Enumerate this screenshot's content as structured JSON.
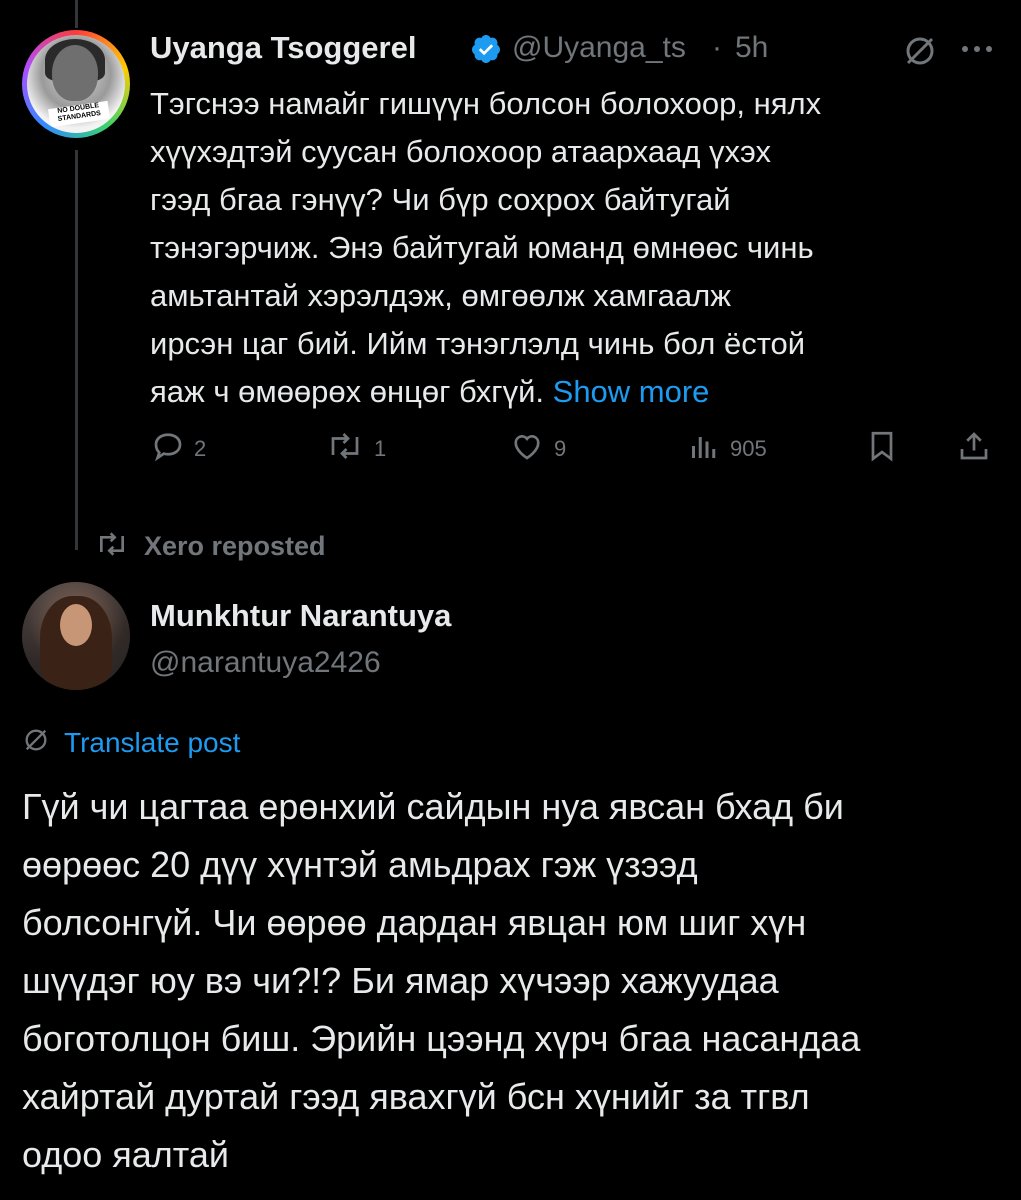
{
  "tweet1": {
    "name": "Uyanga Tsoggerel",
    "handle": "@Uyanga_ts",
    "separator": "·",
    "time": "5h",
    "avatar_badge": "NO DOUBLE STANDARDS",
    "text_lines": [
      "Тэгснээ намайг гишүүн болсон болохоор, нялх",
      "хүүхэдтэй суусан болохоор атаархаад үхэх",
      "гээд бгаа гэнүү? Чи бүр сохрох байтугай",
      "тэнэгэрчиж. Энэ байтугай юманд өмнөөс чинь",
      "амьтантай хэрэлдэж, өмгөөлж хамгаалж",
      "ирсэн цаг бий. Ийм тэнэглэлд чинь бол ёстой"
    ],
    "last_line": "яаж ч өмөөрөх өнцөг бхгүй.",
    "show_more": "Show more",
    "replies": "2",
    "reposts": "1",
    "likes": "9",
    "views": "905"
  },
  "repost_label": "Xero reposted",
  "tweet2": {
    "name": "Munkhtur Narantuya",
    "handle": "@narantuya2426",
    "translate": "Translate post",
    "text_lines": [
      "Гүй чи цагтаа ерөнхий сайдын нуа явсан бхад би",
      "өөрөөс 20 дүү хүнтэй амьдрах гэж үзээд",
      "болсонгүй. Чи өөрөө дардан явцан юм шиг хүн",
      "шүүдэг юу вэ чи?!? Би ямар хүчээр хажуудаа",
      "боготолцон биш. Эрийн цээнд хүрч бгаа насандаа",
      "хайртай дуртай гээд явахгүй бсн хүнийг за тгвл",
      "одоо яалтай"
    ]
  },
  "colors": {
    "background": "#000000",
    "text": "#e7e9ea",
    "muted": "#71767b",
    "accent": "#1d9bf0"
  },
  "icons": [
    "verified-icon",
    "grok-icon",
    "more-icon",
    "reply-icon",
    "repost-icon",
    "like-icon",
    "views-icon",
    "bookmark-icon",
    "share-icon",
    "translate-icon"
  ]
}
